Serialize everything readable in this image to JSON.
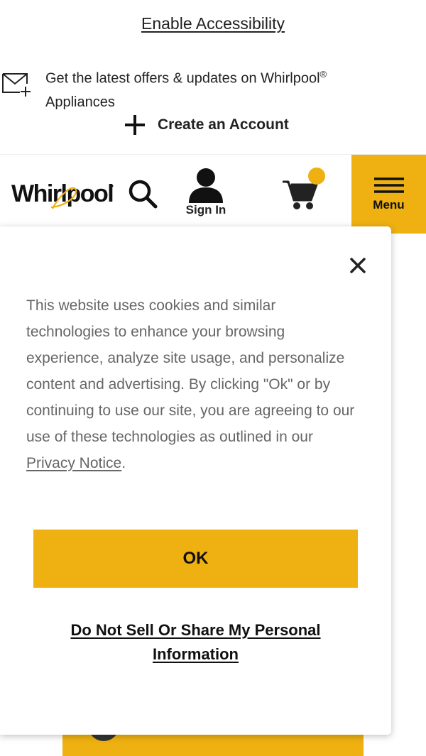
{
  "accessibility": {
    "label": "Enable Accessibility"
  },
  "offers": {
    "text": "Get the latest offers & updates on Whirlpool",
    "reg": "®",
    "text2": "Appliances"
  },
  "create_account": {
    "label": "Create an Account"
  },
  "header": {
    "logo_alt": "Whirlpool",
    "sign_in_label": "Sign In",
    "menu_label": "Menu"
  },
  "cookie_modal": {
    "message": "This website uses cookies and similar technologies to enhance your browsing experience, analyze site usage, and personalize content and advertising. By clicking \"Ok\" or by continuing to use our site, you are agreeing to our use of these technologies as outlined in our ",
    "privacy_link": "Privacy Notice",
    "period": ".",
    "ok_label": "OK",
    "do_not_sell_label": "Do Not Sell Or Share My Personal Information"
  },
  "colors": {
    "brand_yellow": "#eeb111",
    "text_dark": "#111111",
    "text_muted": "#666666"
  }
}
